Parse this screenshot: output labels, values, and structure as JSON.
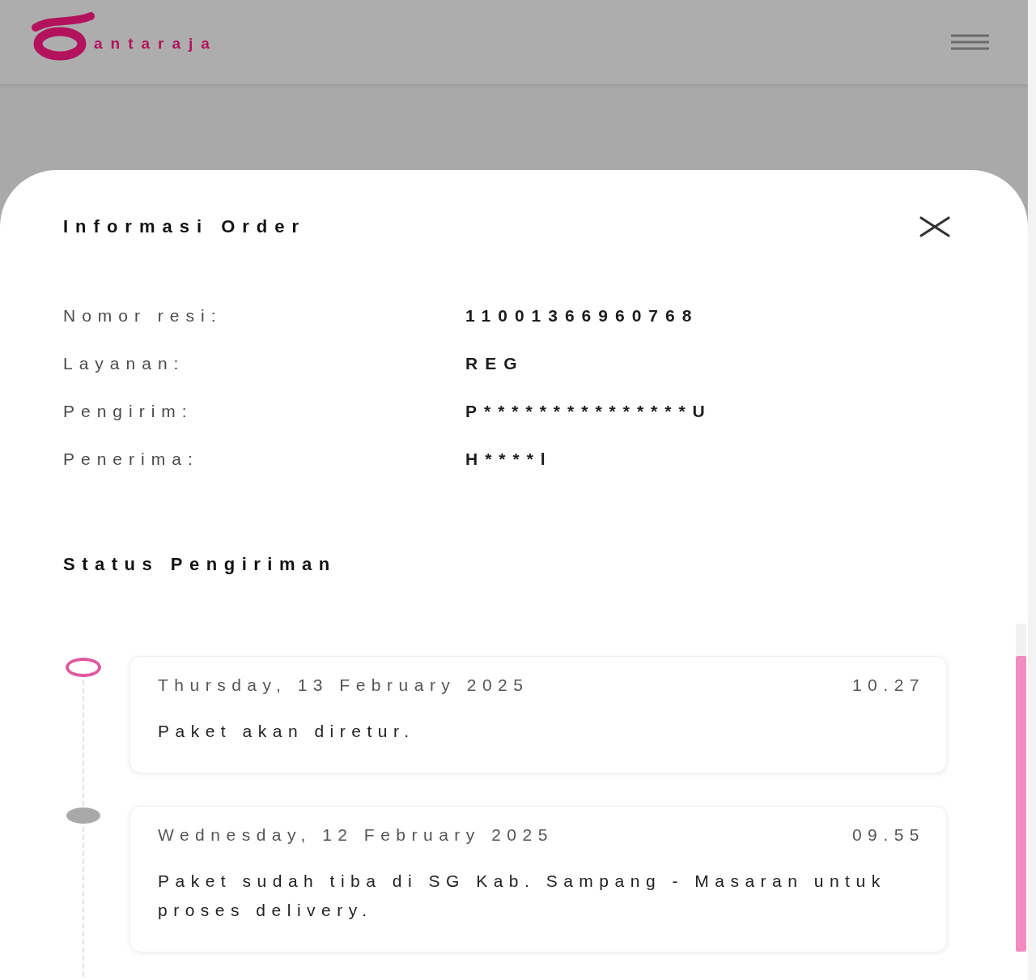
{
  "header": {
    "logo_text": "antaraja"
  },
  "sheet": {
    "title": "Informasi Order",
    "fields": [
      {
        "label": "Nomor resi:",
        "value": "11001366960768"
      },
      {
        "label": "Layanan:",
        "value": "REG"
      },
      {
        "label": "Pengirim:",
        "value": "P***************U"
      },
      {
        "label": "Penerima:",
        "value": "H****l"
      }
    ],
    "section_title": "Status Pengiriman",
    "timeline": [
      {
        "date": "Thursday, 13 February 2025",
        "time": "10.27",
        "description": "Paket akan diretur.",
        "current": true
      },
      {
        "date": "Wednesday, 12 February 2025",
        "time": "09.55",
        "description": "Paket sudah tiba di SG Kab. Sampang - Masaran untuk proses delivery.",
        "current": false
      }
    ]
  }
}
